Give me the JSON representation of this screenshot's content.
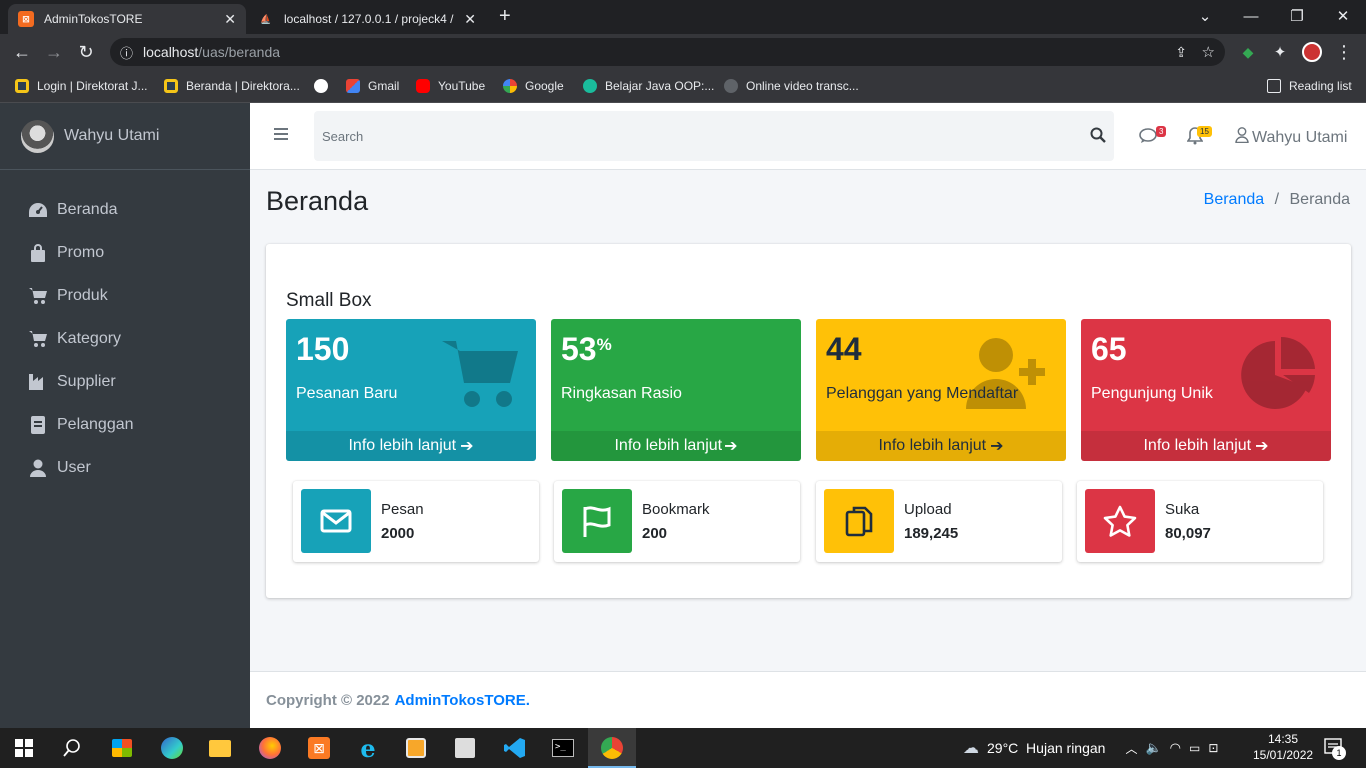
{
  "browser": {
    "tabs": [
      {
        "title": "AdminTokosTORE",
        "active": true
      },
      {
        "title": "localhost / 127.0.0.1 / projeck4 / ",
        "active": false
      }
    ],
    "new_tab": "+",
    "url_host": "localhost",
    "url_path": "/uas/beranda",
    "bookmarks": [
      {
        "label": "Login | Direktorat J...",
        "color": "#f5c518"
      },
      {
        "label": "Beranda | Direktora...",
        "color": "#f5c518"
      },
      {
        "label": "",
        "color": "#ffffff"
      },
      {
        "label": "Gmail",
        "color": "#ea4335"
      },
      {
        "label": "YouTube",
        "color": "#ff0000"
      },
      {
        "label": "Google",
        "color": "#4285f4"
      },
      {
        "label": "Belajar Java OOP:...",
        "color": "#1abc9c"
      },
      {
        "label": "Online video transc...",
        "color": "#9aa0a6"
      }
    ],
    "reading_list": "Reading list"
  },
  "sidebar": {
    "user_name": "Wahyu Utami",
    "items": [
      {
        "label": "Beranda",
        "icon": "dashboard-icon"
      },
      {
        "label": "Promo",
        "icon": "shopping-bag-icon"
      },
      {
        "label": "Produk",
        "icon": "cart-icon"
      },
      {
        "label": "Kategory",
        "icon": "cart-icon"
      },
      {
        "label": "Supplier",
        "icon": "industry-icon"
      },
      {
        "label": "Pelanggan",
        "icon": "list-icon"
      },
      {
        "label": "User",
        "icon": "user-icon"
      }
    ]
  },
  "topnav": {
    "search_placeholder": "Search",
    "messages_badge": "3",
    "notifications_badge": "15",
    "user_name": "Wahyu Utami"
  },
  "content": {
    "page_title": "Beranda",
    "breadcrumb": {
      "link": "Beranda",
      "separator": "/",
      "current": "Beranda"
    },
    "card_title": "Small Box",
    "small_boxes": [
      {
        "value": "150",
        "suffix": "",
        "label": "Pesanan Baru",
        "footer": "Info lebih lanjut",
        "color": "#17a2b8",
        "icon": "cart-icon"
      },
      {
        "value": "53",
        "suffix": "%",
        "label": "Ringkasan Rasio",
        "footer": "Info lebih lanjut",
        "color": "#28a745",
        "icon": "chart-icon"
      },
      {
        "value": "44",
        "suffix": "",
        "label": "Pelanggan yang Mendaftar",
        "footer": "Info lebih lanjut",
        "color": "#ffc107",
        "icon": "user-plus-icon"
      },
      {
        "value": "65",
        "suffix": "",
        "label": "Pengunjung Unik",
        "footer": "Info lebih lanjut",
        "color": "#dc3545",
        "icon": "pie-chart-icon"
      }
    ],
    "info_boxes": [
      {
        "label": "Pesan",
        "value": "2000",
        "color": "#17a2b8",
        "icon": "envelope-icon"
      },
      {
        "label": "Bookmark",
        "value": "200",
        "color": "#28a745",
        "icon": "flag-icon"
      },
      {
        "label": "Upload",
        "value": "189,245",
        "color": "#ffc107",
        "icon": "copy-icon"
      },
      {
        "label": "Suka",
        "value": "80,097",
        "color": "#dc3545",
        "icon": "star-icon"
      }
    ]
  },
  "footer": {
    "copyright": "Copyright © 2022",
    "brand": "AdminTokosTORE."
  },
  "taskbar": {
    "weather": "29°C  Hujan ringan",
    "time": "14:35",
    "date": "15/01/2022",
    "notification_count": "1"
  }
}
